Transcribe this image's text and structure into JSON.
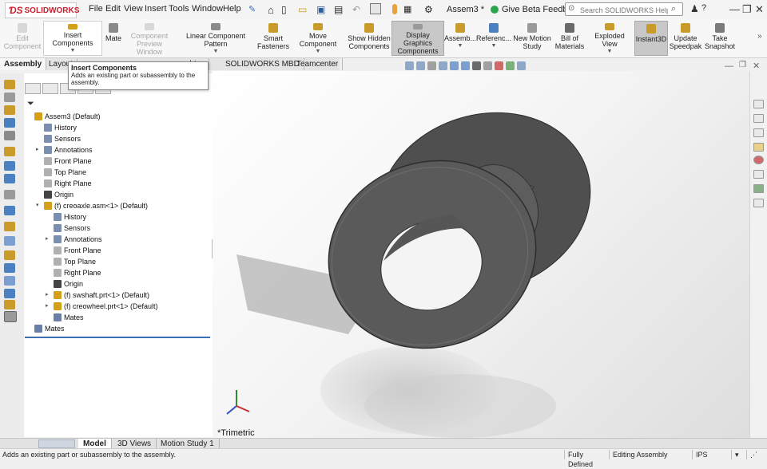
{
  "app": {
    "logo_text": "SOLIDWORKS",
    "doc_title": "Assem3 *"
  },
  "menu": [
    "File",
    "Edit",
    "View",
    "Insert",
    "Tools",
    "Window",
    "Help"
  ],
  "title_actions": {
    "beta_feedback": "Give Beta Feedback"
  },
  "search": {
    "placeholder": "Search SOLIDWORKS Help"
  },
  "command_manager": [
    {
      "id": "edit-component",
      "label": "Edit Component",
      "disabled": true
    },
    {
      "id": "insert-components",
      "label": "Insert Components"
    },
    {
      "id": "mate",
      "label": "Mate"
    },
    {
      "id": "component-preview",
      "label": "Component Preview Window",
      "disabled": true
    },
    {
      "id": "linear-pattern",
      "label": "Linear Component Pattern"
    },
    {
      "id": "smart-fasteners",
      "label": "Smart Fasteners"
    },
    {
      "id": "move-component",
      "label": "Move Component"
    },
    {
      "id": "show-hidden",
      "label": "Show Hidden Components"
    },
    {
      "id": "display-graphics",
      "label": "Display Graphics Components",
      "active": true
    },
    {
      "id": "assembly-features",
      "label": "Assemb..."
    },
    {
      "id": "reference-geometry",
      "label": "Referenc..."
    },
    {
      "id": "new-motion-study",
      "label": "New Motion Study"
    },
    {
      "id": "bill-of-materials",
      "label": "Bill of Materials"
    },
    {
      "id": "exploded-view",
      "label": "Exploded View"
    },
    {
      "id": "instant3d",
      "label": "Instant3D",
      "active": true
    },
    {
      "id": "update-speedpak",
      "label": "Update Speedpak"
    },
    {
      "id": "take-snapshot",
      "label": "Take Snapshot"
    }
  ],
  "cm_tabs": [
    "Assembly",
    "Layout",
    "d-Ins",
    "SOLIDWORKS MBD",
    "Teamcenter"
  ],
  "tooltip": {
    "title": "Insert Components",
    "body": "Adds an existing part or subassembly to the assembly."
  },
  "tree": [
    {
      "label": "Assem3  (Default)",
      "level": 0,
      "icon": "assembly-icon",
      "color": "#d4a017"
    },
    {
      "label": "History",
      "level": 1,
      "icon": "history-icon",
      "color": "#7a8fb0"
    },
    {
      "label": "Sensors",
      "level": 1,
      "icon": "sensor-icon",
      "color": "#7a8fb0"
    },
    {
      "label": "Annotations",
      "level": 1,
      "icon": "annotations-icon",
      "color": "#7a8fb0",
      "expander": true
    },
    {
      "label": "Front Plane",
      "level": 1,
      "icon": "plane-icon",
      "color": "#b0b0b0"
    },
    {
      "label": "Top Plane",
      "level": 1,
      "icon": "plane-icon",
      "color": "#b0b0b0"
    },
    {
      "label": "Right Plane",
      "level": 1,
      "icon": "plane-icon",
      "color": "#b0b0b0"
    },
    {
      "label": "Origin",
      "level": 1,
      "icon": "origin-icon",
      "color": "#444444"
    },
    {
      "label": "(f) creoaxle.asm<1> (Default)",
      "level": 1,
      "icon": "subassembly-icon",
      "color": "#d4a017",
      "expander": true,
      "expanded": true
    },
    {
      "label": "History",
      "level": 2,
      "icon": "history-icon",
      "color": "#7a8fb0"
    },
    {
      "label": "Sensors",
      "level": 2,
      "icon": "sensor-icon",
      "color": "#7a8fb0"
    },
    {
      "label": "Annotations",
      "level": 2,
      "icon": "annotations-icon",
      "color": "#7a8fb0",
      "expander": true
    },
    {
      "label": "Front Plane",
      "level": 2,
      "icon": "plane-icon",
      "color": "#b0b0b0"
    },
    {
      "label": "Top Plane",
      "level": 2,
      "icon": "plane-icon",
      "color": "#b0b0b0"
    },
    {
      "label": "Right Plane",
      "level": 2,
      "icon": "plane-icon",
      "color": "#b0b0b0"
    },
    {
      "label": "Origin",
      "level": 2,
      "icon": "origin-icon",
      "color": "#444444"
    },
    {
      "label": "(f) swshaft.prt<1> (Default)",
      "level": 2,
      "icon": "part-icon",
      "color": "#d4a017",
      "expander": true
    },
    {
      "label": "(f) creowheel.prt<1> (Default)",
      "level": 2,
      "icon": "part-icon",
      "color": "#d4a017",
      "expander": true
    },
    {
      "label": "Mates",
      "level": 2,
      "icon": "mates-icon",
      "color": "#6a7fa8"
    },
    {
      "label": "Mates",
      "level": 0,
      "icon": "mates-icon",
      "color": "#6a7fa8"
    }
  ],
  "view": {
    "orientation": "*Trimetric"
  },
  "bottom_tabs": [
    "Model",
    "3D Views",
    "Motion Study 1"
  ],
  "status": {
    "message": "Adds an existing part or subassembly to the assembly.",
    "definition": "Fully Defined",
    "mode": "Editing Assembly",
    "units": "IPS"
  },
  "colors": {
    "accent": "#3b6fb4",
    "brand": "#c8202f",
    "model": "#5a5a5a"
  }
}
